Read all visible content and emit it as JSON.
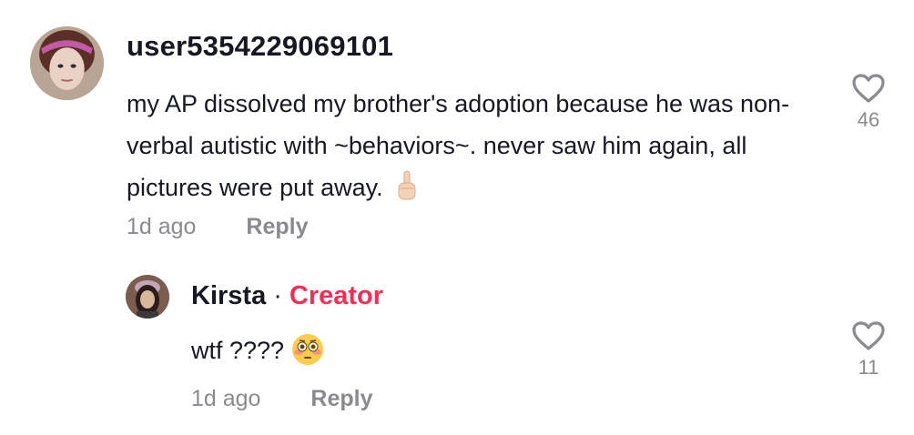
{
  "comment": {
    "username": "user5354229069101",
    "text": "my AP dissolved my brother's adoption because he was non-verbal autistic with ~behaviors~. never saw him again, all pictures were put away.",
    "emoji": "middle-finger-emoji",
    "time": "1d ago",
    "reply_label": "Reply",
    "like_count": "46"
  },
  "reply": {
    "username": "Kirsta",
    "separator": "·",
    "badge": "Creator",
    "text": "wtf ????",
    "emoji": "flushed-face-emoji",
    "time": "1d ago",
    "reply_label": "Reply",
    "like_count": "11"
  },
  "colors": {
    "text": "#161823",
    "muted": "#8a8b91",
    "creator": "#fe2c55"
  }
}
